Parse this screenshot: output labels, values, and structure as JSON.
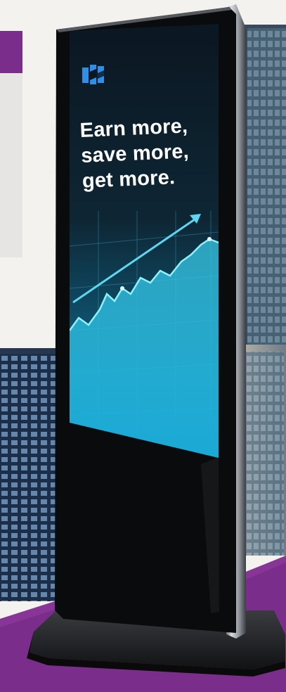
{
  "ad": {
    "headline": {
      "line1": "Earn more,",
      "line2": "save more,",
      "line3": "get more."
    },
    "logo_icon": "brand-logo-icon",
    "chart_icon": "rising-chart-graphic"
  },
  "colors": {
    "purple": "#7b2d8b",
    "screen_dark": "#0c1a28",
    "chart_cyan": "#3fd0e8",
    "logo_blue": "#2f8fe8"
  }
}
